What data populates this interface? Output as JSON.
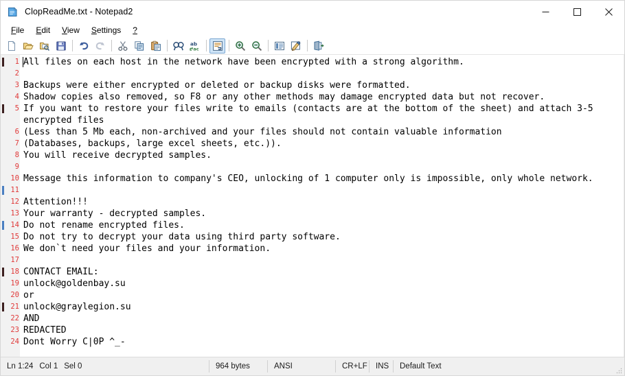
{
  "window": {
    "title": "ClopReadMe.txt - Notepad2",
    "app_icon": "document-icon",
    "controls": {
      "minimize": "minimize-icon",
      "maximize": "maximize-icon",
      "close": "close-icon"
    }
  },
  "menubar": {
    "items": [
      {
        "label": "File",
        "accel": "F"
      },
      {
        "label": "Edit",
        "accel": "E"
      },
      {
        "label": "View",
        "accel": "V"
      },
      {
        "label": "Settings",
        "accel": "S"
      },
      {
        "label": "?",
        "accel": "?"
      }
    ]
  },
  "toolbar": {
    "buttons": [
      {
        "name": "new-file-icon",
        "title": "New"
      },
      {
        "name": "open-file-icon",
        "title": "Open"
      },
      {
        "name": "browse-file-icon",
        "title": "Open Recent"
      },
      {
        "name": "save-file-icon",
        "title": "Save"
      },
      {
        "name": "undo-icon",
        "title": "Undo"
      },
      {
        "name": "redo-icon",
        "title": "Redo"
      },
      {
        "name": "cut-icon",
        "title": "Cut"
      },
      {
        "name": "copy-icon",
        "title": "Copy"
      },
      {
        "name": "paste-icon",
        "title": "Paste"
      },
      {
        "name": "find-icon",
        "title": "Find"
      },
      {
        "name": "replace-icon",
        "title": "Replace"
      },
      {
        "name": "word-wrap-icon",
        "title": "Word Wrap"
      },
      {
        "name": "zoom-in-icon",
        "title": "Zoom In"
      },
      {
        "name": "zoom-out-icon",
        "title": "Zoom Out"
      },
      {
        "name": "scheme-icon",
        "title": "Scheme"
      },
      {
        "name": "customize-scheme-icon",
        "title": "Customize Scheme"
      },
      {
        "name": "exit-icon",
        "title": "Exit"
      }
    ]
  },
  "editor": {
    "lines": [
      {
        "num": "1",
        "text": "All files on each host in the network have been encrypted with a strong algorithm.",
        "marker": "dark"
      },
      {
        "num": "2",
        "text": "",
        "marker": ""
      },
      {
        "num": "3",
        "text": "Backups were either encrypted or deleted or backup disks were formatted.",
        "marker": ""
      },
      {
        "num": "4",
        "text": "Shadow copies also removed, so F8 or any other methods may damage encrypted data but not recover.",
        "marker": ""
      },
      {
        "num": "5",
        "text": "If you want to restore your files write to emails (contacts are at the bottom of the sheet) and attach 3-5",
        "marker": "dark"
      },
      {
        "num": "",
        "text": "encrypted files",
        "marker": ""
      },
      {
        "num": "6",
        "text": "(Less than 5 Mb each, non-archived and your files should not contain valuable information",
        "marker": ""
      },
      {
        "num": "7",
        "text": "(Databases, backups, large excel sheets, etc.)).",
        "marker": ""
      },
      {
        "num": "8",
        "text": "You will receive decrypted samples.",
        "marker": ""
      },
      {
        "num": "9",
        "text": "",
        "marker": ""
      },
      {
        "num": "10",
        "text": "Message this information to company's CEO, unlocking of 1 computer only is impossible, only whole network.",
        "marker": ""
      },
      {
        "num": "11",
        "text": "",
        "marker": "blue"
      },
      {
        "num": "12",
        "text": "Attention!!!",
        "marker": ""
      },
      {
        "num": "13",
        "text": "Your warranty - decrypted samples.",
        "marker": ""
      },
      {
        "num": "14",
        "text": "Do not rename encrypted files.",
        "marker": "blue"
      },
      {
        "num": "15",
        "text": "Do not try to decrypt your data using third party software.",
        "marker": ""
      },
      {
        "num": "16",
        "text": "We don`t need your files and your information.",
        "marker": ""
      },
      {
        "num": "17",
        "text": "",
        "marker": ""
      },
      {
        "num": "18",
        "text": "CONTACT EMAIL:",
        "marker": "dark"
      },
      {
        "num": "19",
        "text": "unlock@goldenbay.su",
        "marker": ""
      },
      {
        "num": "20",
        "text": "or",
        "marker": ""
      },
      {
        "num": "21",
        "text": "unlock@graylegion.su",
        "marker": "dark"
      },
      {
        "num": "22",
        "text": "AND",
        "marker": ""
      },
      {
        "num": "23",
        "text": "REDACTED",
        "marker": ""
      },
      {
        "num": "24",
        "text": "Dont Worry C|0P ^_-",
        "marker": ""
      }
    ]
  },
  "statusbar": {
    "position": "Ln 1:24",
    "column": "Col 1",
    "selection": "Sel 0",
    "bytes": "964 bytes",
    "encoding": "ANSI",
    "eol": "CR+LF",
    "insert_mode": "INS",
    "scheme": "Default Text"
  },
  "colors": {
    "line_number": "#e03a3a",
    "gutter_bg": "#f2f2f2",
    "marker_dark": "#3d2020",
    "marker_blue": "#4a7fc1",
    "statusbar_bg": "#f0f0f0",
    "toolbar_active": "#cfe4f7"
  }
}
